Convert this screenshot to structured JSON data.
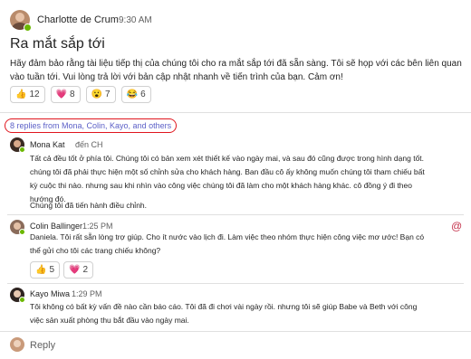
{
  "post": {
    "author": "Charlotte de Crum",
    "time": "9:30 AM",
    "title": "Ra mắt sắp tới",
    "body": "Hãy đảm bảo rằng tài liệu tiếp thị của chúng tôi cho ra mắt sắp tới đã sẵn sàng. Tôi sẽ họp với các bên liên quan vào tuần tới. Vui lòng trả lời với bản cập nhật nhanh về tiến trình của bạn. Cảm ơn!",
    "reactions": [
      {
        "icon": "thumbs-up-icon",
        "glyph": "👍",
        "count": "12"
      },
      {
        "icon": "heart-icon",
        "glyph": "💗",
        "count": "8"
      },
      {
        "icon": "surprised-icon",
        "glyph": "😮",
        "count": "7"
      },
      {
        "icon": "laugh-icon",
        "glyph": "😂",
        "count": "6"
      }
    ]
  },
  "replies_link": "8 replies from Mona, Colin, Kayo, and others",
  "replies": [
    {
      "author": "Mona Kat",
      "time": "đến CH",
      "body": "Tất cả đều tốt ở phía tôi. Chúng tôi có bản xem xét thiết kế vào ngày mai, và sau đó cũng được trong hình dạng tốt. chúng tôi đã phải thực hiện một số chỉnh sửa cho khách hàng. Ban đầu cô ấy không muốn chúng tôi tham chiếu bất kỳ cuộc thi nào. nhưng sau khi nhìn vào công việc chúng tôi đã làm cho một khách hàng khác. cô đồng ý đi theo hướng đó.",
      "body2": "Chúng tôi đã tiến hành điều chỉnh."
    },
    {
      "author": "Colin Ballinger",
      "time": "1:25 PM",
      "body": "Daniela. Tôi rất sẵn lòng trợ giúp. Cho ít nước vào lịch đi. Làm việc theo nhóm thực hiện công việc mơ ước! Bạn có thể gửi cho tôi các trang chiếu không?",
      "reactions": [
        {
          "icon": "thumbs-up-icon",
          "glyph": "👍",
          "count": "5"
        },
        {
          "icon": "heart-icon",
          "glyph": "💗",
          "count": "2"
        }
      ]
    },
    {
      "author": "Kayo Miwa",
      "time": "1:29 PM",
      "body": "Tôi không có bất kỳ vấn đề nào cần báo cáo. Tôi đã đi chơi vài ngày rồi. nhưng tôi sẽ giúp Babe và Beth với công việc sản xuất phòng thu bắt đầu vào ngày mai."
    }
  ],
  "mention_icon": "at-icon",
  "reply_placeholder": "Reply",
  "colors": {
    "link": "#5b5fc7",
    "highlight_border": "#e0161e",
    "presence": "#6bb700",
    "mention": "#c4314b"
  }
}
